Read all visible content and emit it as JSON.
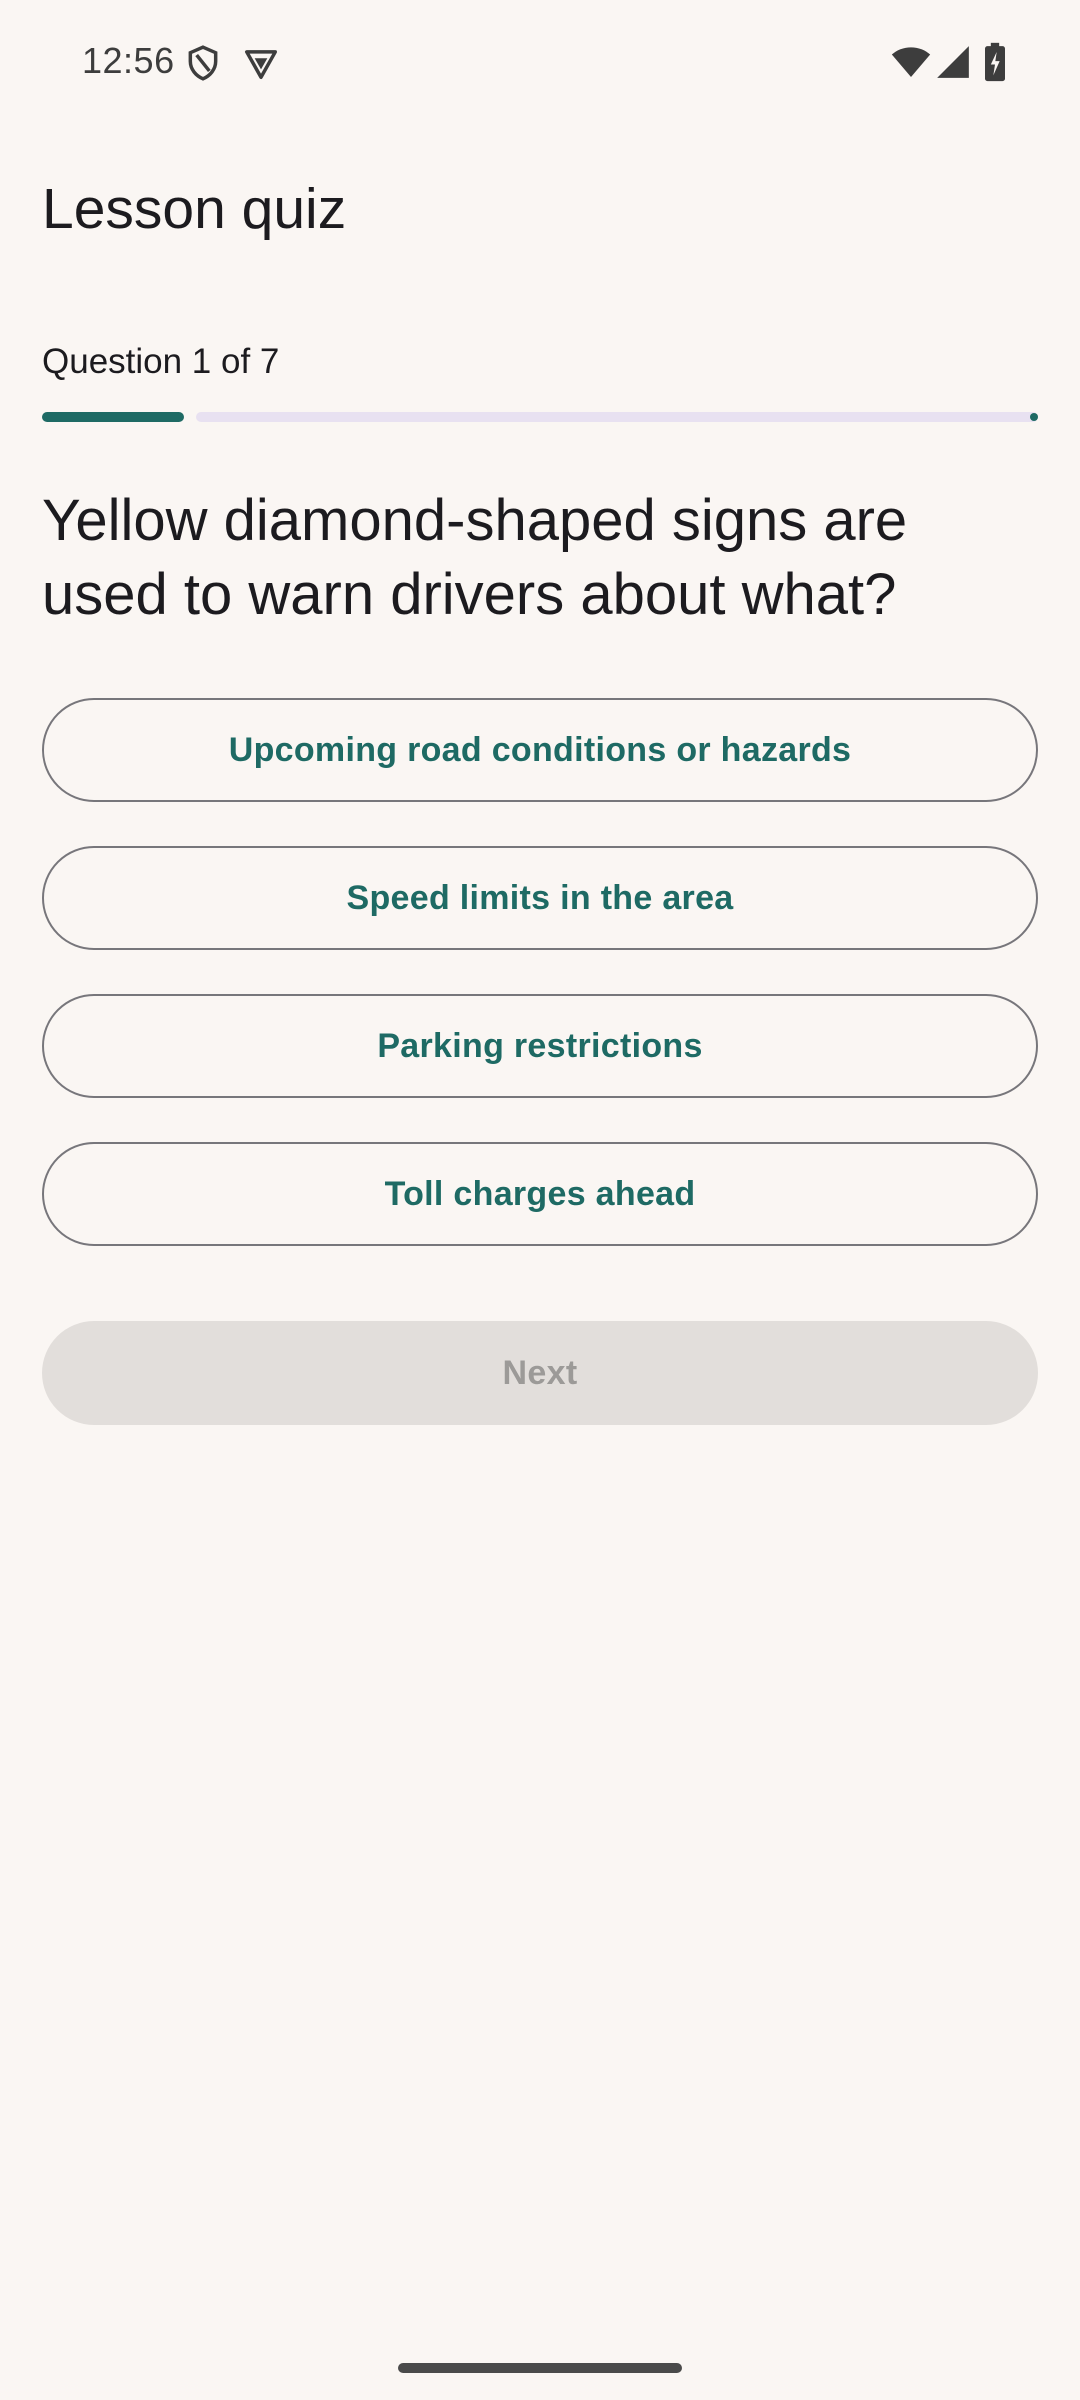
{
  "status_bar": {
    "time": "12:56",
    "left_icons": [
      "shield-icon",
      "vpn-badge-icon"
    ],
    "right_icons": [
      "wifi-icon",
      "cellular-signal-icon",
      "battery-charging-icon"
    ]
  },
  "page": {
    "title": "Lesson quiz"
  },
  "progress": {
    "label": "Question 1 of 7",
    "current": 1,
    "total": 7,
    "accent_color": "#1E6A64",
    "track_color": "#E8E1F1"
  },
  "question": {
    "text": "Yellow diamond-shaped signs are used to warn drivers about what?"
  },
  "answers": [
    {
      "label": "Upcoming road conditions or hazards"
    },
    {
      "label": "Speed limits in the area"
    },
    {
      "label": "Parking restrictions"
    },
    {
      "label": "Toll charges ahead"
    }
  ],
  "next_button": {
    "label": "Next",
    "enabled": false
  },
  "colors": {
    "background": "#FAF6F3",
    "answer_text": "#1E6A64",
    "answer_outline": "#77767B",
    "disabled_bg": "#E2DEDB",
    "disabled_text": "#9C9A98"
  }
}
